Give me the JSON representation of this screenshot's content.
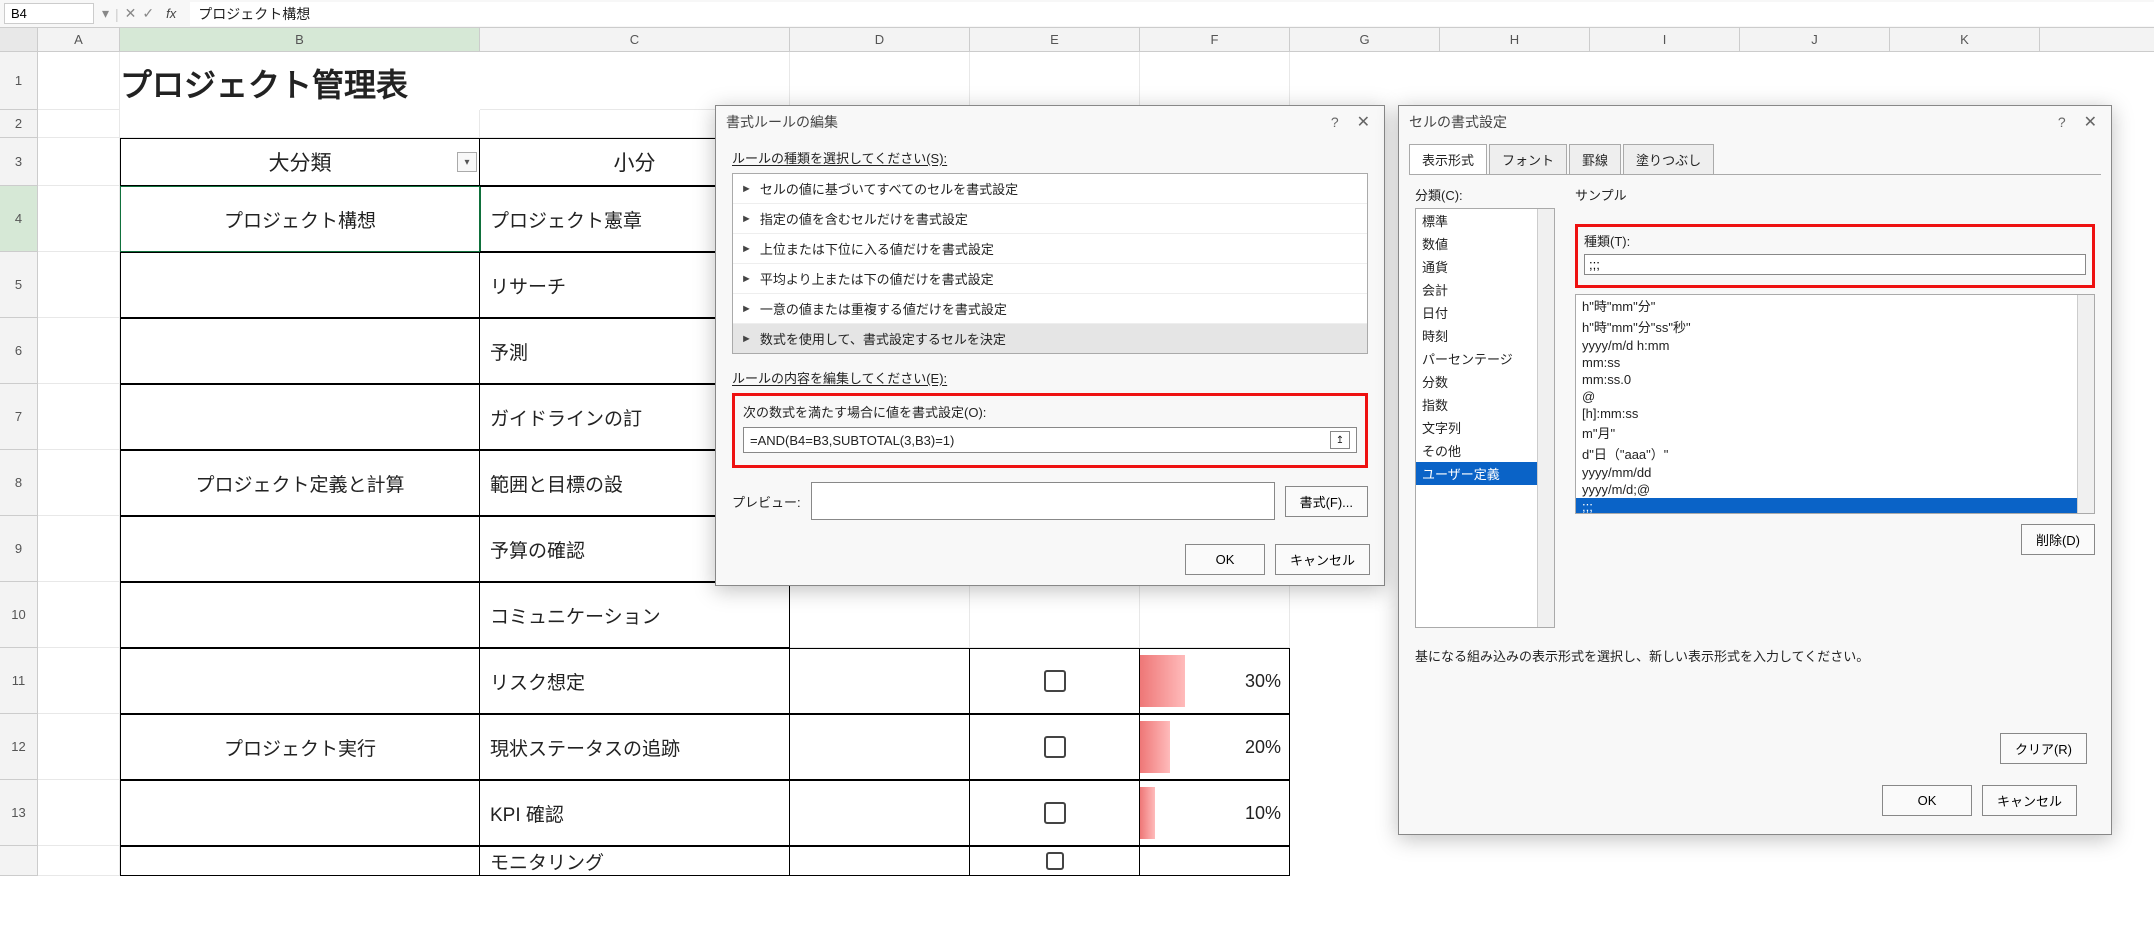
{
  "formula_bar": {
    "cell_ref": "B4",
    "fx": "fx",
    "content": "プロジェクト構想"
  },
  "columns": [
    "A",
    "B",
    "C",
    "D",
    "E",
    "F",
    "G",
    "H",
    "I",
    "J",
    "K"
  ],
  "rows": [
    "1",
    "2",
    "3",
    "4",
    "5",
    "6",
    "7",
    "8",
    "9",
    "10",
    "11",
    "12",
    "13"
  ],
  "sheet": {
    "title": "プロジェクト管理表",
    "header_b": "大分類",
    "header_c": "小分",
    "b4": "プロジェクト構想",
    "b8": "プロジェクト定義と計算",
    "b12": "プロジェクト実行",
    "c_vals": {
      "r4": "プロジェクト憲章",
      "r5": "リサーチ",
      "r6": "予測",
      "r7": "ガイドラインの訂",
      "r8": "範囲と目標の設",
      "r9": "予算の確認",
      "r10": "コミュニケーション",
      "r11": "リスク想定",
      "r12": "現状ステータスの追跡",
      "r13": "KPI 確認",
      "r14": "モニタリング"
    },
    "f_vals": {
      "r11": "30%",
      "r12": "20%",
      "r13": "10%"
    }
  },
  "rule_dialog": {
    "title": "書式ルールの編集",
    "select_label": "ルールの種類を選択してください(S):",
    "items": [
      "セルの値に基づいてすべてのセルを書式設定",
      "指定の値を含むセルだけを書式設定",
      "上位または下位に入る値だけを書式設定",
      "平均より上または下の値だけを書式設定",
      "一意の値または重複する値だけを書式設定",
      "数式を使用して、書式設定するセルを決定"
    ],
    "edit_label": "ルールの内容を編集してください(E):",
    "formula_label": "次の数式を満たす場合に値を書式設定(O):",
    "formula_value": "=AND(B4=B3,SUBTOTAL(3,B3)=1)",
    "preview_label": "プレビュー:",
    "format_btn": "書式(F)...",
    "ok": "OK",
    "cancel": "キャンセル"
  },
  "format_dialog": {
    "title": "セルの書式設定",
    "tabs": [
      "表示形式",
      "フォント",
      "罫線",
      "塗りつぶし"
    ],
    "category_label": "分類(C):",
    "categories": [
      "標準",
      "数値",
      "通貨",
      "会計",
      "日付",
      "時刻",
      "パーセンテージ",
      "分数",
      "指数",
      "文字列",
      "その他",
      "ユーザー定義"
    ],
    "sample_label": "サンプル",
    "type_label": "種類(T):",
    "type_value": ";;;",
    "type_list": [
      "h\"時\"mm\"分\"",
      "h\"時\"mm\"分\"ss\"秒\"",
      "yyyy/m/d h:mm",
      "mm:ss",
      "mm:ss.0",
      "@",
      "[h]:mm:ss",
      "m\"月\"",
      "d\"日（\"aaa\"）\"",
      "yyyy/mm/dd",
      "yyyy/m/d;@",
      ";;;"
    ],
    "delete_btn": "削除(D)",
    "hint": "基になる組み込みの表示形式を選択し、新しい表示形式を入力してください。",
    "clear_btn": "クリア(R)",
    "ok": "OK",
    "cancel": "キャンセル"
  }
}
